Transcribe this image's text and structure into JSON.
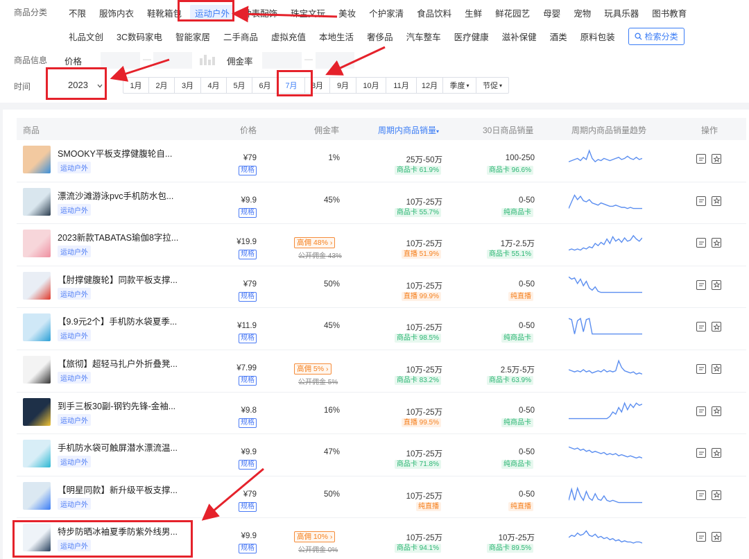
{
  "filters": {
    "category_label": "商品分类",
    "categories_row1": [
      "不限",
      "服饰内衣",
      "鞋靴箱包",
      "运动户外",
      "钟表配饰",
      "珠宝文玩",
      "美妆",
      "个护家清",
      "食品饮料",
      "生鲜",
      "鲜花园艺",
      "母婴",
      "宠物",
      "玩具乐器",
      "图书教育"
    ],
    "categories_row2": [
      "礼品文创",
      "3C数码家电",
      "智能家居",
      "二手商品",
      "虚拟充值",
      "本地生活",
      "奢侈品",
      "汽车整车",
      "医疗健康",
      "滋补保健",
      "酒类",
      "原料包装"
    ],
    "active_category": "运动户外",
    "search_category_label": "检索分类",
    "info_label": "商品信息",
    "price_label": "价格",
    "commission_label": "佣金率",
    "range_sep": "—",
    "time_label": "时间",
    "year": "2023",
    "months": [
      "1月",
      "2月",
      "3月",
      "4月",
      "5月",
      "6月",
      "7月",
      "8月",
      "9月",
      "10月",
      "11月",
      "12月"
    ],
    "active_month": "7月",
    "quarter_label": "季度",
    "festival_label": "节促"
  },
  "table": {
    "headers": {
      "product": "商品",
      "price": "价格",
      "commission": "佣金率",
      "period_sales": "周期内商品销量",
      "sales_30d": "30日商品销量",
      "trend": "周期内商品销量趋势",
      "actions": "操作"
    },
    "spec_label": "规格",
    "rows": [
      {
        "title": "SMOOKY平板支撑健腹轮自...",
        "tag": "运动户外",
        "price": "¥79",
        "commission": "1%",
        "period_sales": "25万-50万",
        "period_badge": "商品卡 61.9%",
        "period_badge_type": "green",
        "sales_30d": "100-250",
        "badge_30d": "商品卡 96.6%",
        "badge_30d_type": "green",
        "trend": [
          0.4,
          0.45,
          0.5,
          0.55,
          0.45,
          0.6,
          0.5,
          0.9,
          0.55,
          0.4,
          0.5,
          0.45,
          0.55,
          0.5,
          0.45,
          0.5,
          0.55,
          0.6,
          0.5,
          0.55,
          0.65,
          0.55,
          0.5,
          0.6,
          0.5,
          0.55
        ]
      },
      {
        "title": "漂流沙滩游泳pvc手机防水包...",
        "tag": "运动户外",
        "price": "¥9.9",
        "commission": "45%",
        "period_sales": "10万-25万",
        "period_badge": "商品卡 55.7%",
        "period_badge_type": "green",
        "sales_30d": "0-50",
        "badge_30d": "纯商品卡",
        "badge_30d_type": "green",
        "trend": [
          0.2,
          0.5,
          0.8,
          0.6,
          0.75,
          0.55,
          0.5,
          0.6,
          0.45,
          0.4,
          0.35,
          0.45,
          0.4,
          0.35,
          0.3,
          0.3,
          0.35,
          0.3,
          0.25,
          0.25,
          0.2,
          0.25,
          0.2,
          0.2,
          0.2,
          0.2
        ]
      },
      {
        "title": "2023新款TABATAS瑜伽8字拉...",
        "tag": "运动户外",
        "price": "¥19.9",
        "hi_commission": "高佣 48%",
        "pub_commission": "公开佣金 43%",
        "period_sales": "10万-25万",
        "period_badge": "直播 51.9%",
        "period_badge_type": "orange",
        "sales_30d": "1万-2.5万",
        "badge_30d": "商品卡 55.1%",
        "badge_30d_type": "green",
        "trend": [
          0.2,
          0.25,
          0.2,
          0.25,
          0.2,
          0.3,
          0.25,
          0.35,
          0.3,
          0.5,
          0.4,
          0.55,
          0.45,
          0.7,
          0.5,
          0.8,
          0.6,
          0.7,
          0.55,
          0.75,
          0.6,
          0.65,
          0.85,
          0.7,
          0.6,
          0.75
        ]
      },
      {
        "title": "【肘撑健腹轮】同款平板支撑...",
        "tag": "运动户外",
        "price": "¥79",
        "commission": "50%",
        "period_sales": "10万-25万",
        "period_badge": "直播 99.9%",
        "period_badge_type": "orange",
        "sales_30d": "0-50",
        "badge_30d": "纯直播",
        "badge_30d_type": "orange",
        "trend": [
          0.9,
          0.8,
          0.85,
          0.6,
          0.8,
          0.5,
          0.7,
          0.4,
          0.3,
          0.45,
          0.25,
          0.2,
          0.2,
          0.2,
          0.2,
          0.2,
          0.2,
          0.2,
          0.2,
          0.2,
          0.2,
          0.2,
          0.2,
          0.2,
          0.2,
          0.2
        ]
      },
      {
        "title": "【9.9元2个】手机防水袋夏季...",
        "tag": "运动户外",
        "price": "¥11.9",
        "commission": "45%",
        "period_sales": "10万-25万",
        "period_badge": "商品卡 98.5%",
        "period_badge_type": "green",
        "sales_30d": "0-50",
        "badge_30d": "纯商品卡",
        "badge_30d_type": "green",
        "trend": [
          0.9,
          0.85,
          0.2,
          0.8,
          0.9,
          0.3,
          0.85,
          0.9,
          0.2,
          0.2,
          0.2,
          0.2,
          0.2,
          0.2,
          0.2,
          0.2,
          0.2,
          0.2,
          0.2,
          0.2,
          0.2,
          0.2,
          0.2,
          0.2,
          0.2,
          0.2
        ]
      },
      {
        "title": "【旅彻】超轻马扎户外折叠凳...",
        "tag": "运动户外",
        "price": "¥7.99",
        "hi_commission": "高佣 5%",
        "pub_commission": "公开佣金 5%",
        "period_sales": "10万-25万",
        "period_badge": "商品卡 83.2%",
        "period_badge_type": "green",
        "sales_30d": "2.5万-5万",
        "badge_30d": "商品卡 63.9%",
        "badge_30d_type": "green",
        "trend": [
          0.5,
          0.45,
          0.4,
          0.45,
          0.4,
          0.5,
          0.4,
          0.45,
          0.35,
          0.4,
          0.45,
          0.4,
          0.5,
          0.4,
          0.45,
          0.4,
          0.45,
          0.9,
          0.6,
          0.45,
          0.4,
          0.35,
          0.4,
          0.3,
          0.35,
          0.3
        ]
      },
      {
        "title": "到手三板30副-钢钓先锋-金袖...",
        "tag": "运动户外",
        "price": "¥9.8",
        "commission": "16%",
        "period_sales": "10万-25万",
        "period_badge": "直播 99.5%",
        "period_badge_type": "orange",
        "sales_30d": "0-50",
        "badge_30d": "纯商品卡",
        "badge_30d_type": "green",
        "trend": [
          0.2,
          0.2,
          0.2,
          0.2,
          0.2,
          0.2,
          0.2,
          0.2,
          0.2,
          0.2,
          0.2,
          0.2,
          0.2,
          0.2,
          0.3,
          0.5,
          0.4,
          0.7,
          0.5,
          0.9,
          0.6,
          0.85,
          0.7,
          0.9,
          0.8,
          0.85
        ]
      },
      {
        "title": "手机防水袋可触屏潜水漂流温...",
        "tag": "运动户外",
        "price": "¥9.9",
        "commission": "47%",
        "period_sales": "10万-25万",
        "period_badge": "商品卡 71.8%",
        "period_badge_type": "green",
        "sales_30d": "0-50",
        "badge_30d": "纯商品卡",
        "badge_30d_type": "green",
        "trend": [
          0.8,
          0.75,
          0.7,
          0.75,
          0.65,
          0.7,
          0.6,
          0.65,
          0.55,
          0.6,
          0.55,
          0.5,
          0.55,
          0.45,
          0.5,
          0.45,
          0.5,
          0.4,
          0.45,
          0.4,
          0.35,
          0.4,
          0.35,
          0.3,
          0.35,
          0.3
        ]
      },
      {
        "title": "【明星同款】新升级平板支撑...",
        "tag": "运动户外",
        "price": "¥79",
        "commission": "50%",
        "period_sales": "10万-25万",
        "period_badge": "纯直播",
        "period_badge_type": "orange",
        "sales_30d": "0-50",
        "badge_30d": "纯直播",
        "badge_30d_type": "orange",
        "trend": [
          0.3,
          0.8,
          0.3,
          0.85,
          0.5,
          0.3,
          0.7,
          0.4,
          0.3,
          0.6,
          0.35,
          0.3,
          0.5,
          0.3,
          0.25,
          0.3,
          0.25,
          0.2,
          0.2,
          0.2,
          0.2,
          0.2,
          0.2,
          0.2,
          0.2,
          0.2
        ]
      },
      {
        "title": "特步防晒冰袖夏季防紫外线男...",
        "tag": "运动户外",
        "price": "¥9.9",
        "hi_commission": "高佣 10%",
        "pub_commission": "公开佣金 0%",
        "period_sales": "10万-25万",
        "period_badge": "商品卡 94.1%",
        "period_badge_type": "green",
        "sales_30d": "10万-25万",
        "badge_30d": "商品卡 89.5%",
        "badge_30d_type": "green",
        "trend": [
          0.5,
          0.6,
          0.55,
          0.7,
          0.6,
          0.65,
          0.8,
          0.6,
          0.55,
          0.65,
          0.5,
          0.55,
          0.45,
          0.5,
          0.4,
          0.45,
          0.35,
          0.4,
          0.3,
          0.35,
          0.3,
          0.3,
          0.25,
          0.3,
          0.3,
          0.25
        ]
      }
    ]
  },
  "colors": {
    "accent": "#3a7cf5",
    "annotation_red": "#e5222b",
    "green": "#2bb673",
    "orange": "#f5801e"
  }
}
